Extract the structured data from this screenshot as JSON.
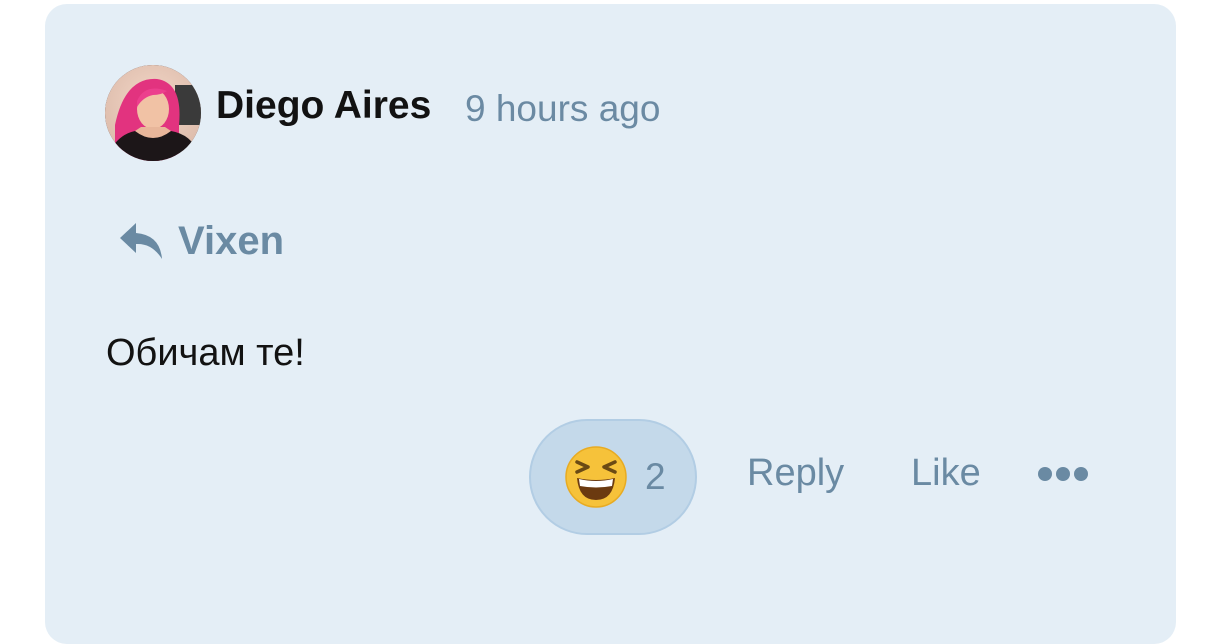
{
  "comment": {
    "author": "Diego Aires",
    "timestamp": "9 hours ago",
    "reply_to": {
      "icon": "reply-arrow-icon",
      "name": "Vixen"
    },
    "text": "Обичам те!",
    "reaction": {
      "emoji": "grinning-squinting-face-icon",
      "count": "2"
    },
    "actions": {
      "reply_label": "Reply",
      "like_label": "Like",
      "more_icon": "more-dots-icon"
    }
  },
  "colors": {
    "card_background": "#e4eef6",
    "muted_text": "#6a8aa3",
    "primary_text": "#121212",
    "reaction_pill": "#c4d9ea"
  }
}
